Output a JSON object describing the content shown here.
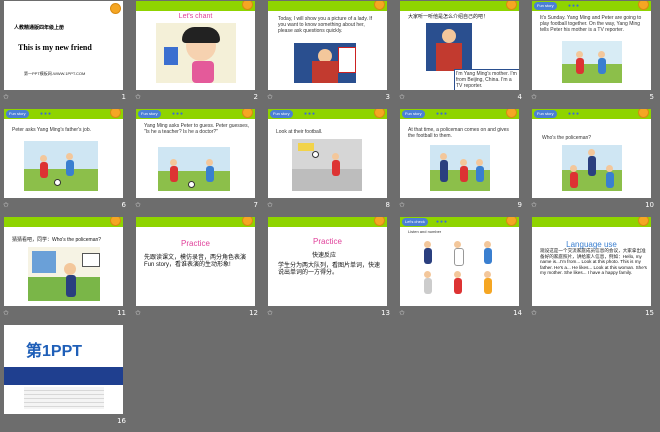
{
  "slides": [
    {
      "num": "1",
      "title": "人教精通版四年级上册",
      "subtitle": "This is my new friend",
      "footer": "第一PPT模板网-WWW.1PPT.COM"
    },
    {
      "num": "2",
      "heading": "Let's chant"
    },
    {
      "num": "3",
      "text": "Today, I will show you a picture of a lady. If you want to know something about her, please ask questions quickly."
    },
    {
      "num": "4",
      "text_top": "大家听一听他是怎么介绍自己的吧！",
      "bubble": "I'm Yang Ming's mother. I'm from Beijing, China. I'm a TV reporter."
    },
    {
      "num": "5",
      "tag": "Fun story",
      "text": "It's Sunday. Yang Ming and Peter are going to play football together. On the way, Yang Ming  tells Peter his mother is a TV reporter."
    },
    {
      "num": "6",
      "tag": "Fun story",
      "text": "Peter asks Yang Ming's father's job."
    },
    {
      "num": "7",
      "tag": "Fun story",
      "text": "Yang Ming asks Peter to guess. Peter guesses, \"Is he a teacher? Is he a doctor?\""
    },
    {
      "num": "8",
      "tag": "Fun story",
      "text": "Look at their football."
    },
    {
      "num": "9",
      "tag": "Fun story",
      "text": "At that time, a policeman comes on and gives the football to them."
    },
    {
      "num": "10",
      "tag": "Fun story",
      "text": "Who's the policeman?"
    },
    {
      "num": "11",
      "text": "猜猜看吧，同学：Who's the policeman?"
    },
    {
      "num": "12",
      "heading": "Practice",
      "text": "先跟读课文，模仿录音，两分角色表演Fun story，看谁表演的生动形象!"
    },
    {
      "num": "13",
      "heading": "Practice",
      "subheading": "快速反应",
      "text": "学生分为两大队列，看图片单词，快速说出单词的一方得分。"
    },
    {
      "num": "14",
      "tag": "Let's check",
      "text": "Listen and number"
    },
    {
      "num": "15",
      "heading": "Language use",
      "text": "观设这是一个交流家庭成员信息的会议，大家拿出准备好的家庭照片，讲给家人信息，例如：Hello, my name is...I'm from... Look at this photo. This is my father. He's a... He likes... Look at this woman. She's my mother. She likes... I have a happy family."
    },
    {
      "num": "16",
      "logo": "第1PPT"
    }
  ],
  "colors": {
    "background": "#6d6d6d",
    "bar": "#8fd400",
    "accent": "#4a7fd6"
  },
  "icons": {
    "star": "star-icon",
    "orange": "orange-icon"
  }
}
